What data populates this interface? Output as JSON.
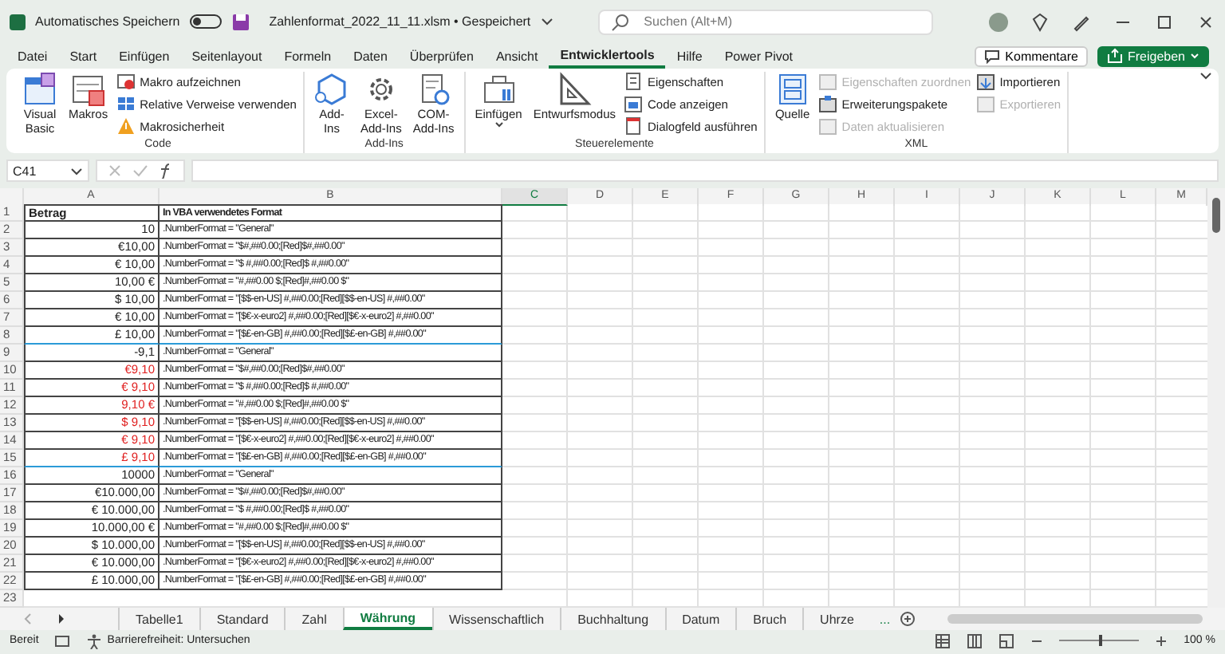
{
  "title_bar": {
    "autosave_label": "Automatisches Speichern",
    "autosave_on": false,
    "filename": "Zahlenformat_2022_11_11.xlsm • Gespeichert",
    "search_placeholder": "Suchen (Alt+M)"
  },
  "menu_tabs": [
    {
      "label": "Datei",
      "selected": false
    },
    {
      "label": "Start",
      "selected": false
    },
    {
      "label": "Einfügen",
      "selected": false
    },
    {
      "label": "Seitenlayout",
      "selected": false
    },
    {
      "label": "Formeln",
      "selected": false
    },
    {
      "label": "Daten",
      "selected": false
    },
    {
      "label": "Überprüfen",
      "selected": false
    },
    {
      "label": "Ansicht",
      "selected": false
    },
    {
      "label": "Entwicklertools",
      "selected": true
    },
    {
      "label": "Hilfe",
      "selected": false
    },
    {
      "label": "Power Pivot",
      "selected": false
    }
  ],
  "header_buttons": {
    "comments": "Kommentare",
    "share": "Freigeben"
  },
  "ribbon_groups": [
    {
      "label": "Code",
      "items": [
        {
          "label": "Visual\nBasic",
          "kind": "large",
          "disabled": false
        },
        {
          "label": "Makros",
          "kind": "large",
          "disabled": false
        },
        {
          "label": "Makro aufzeichnen",
          "kind": "small",
          "disabled": false
        },
        {
          "label": "Relative Verweise verwenden",
          "kind": "small",
          "disabled": false
        },
        {
          "label": "Makrosicherheit",
          "kind": "small",
          "disabled": false
        }
      ]
    },
    {
      "label": "Add-Ins",
      "items": [
        {
          "label": "Add-\nIns",
          "kind": "large",
          "disabled": false
        },
        {
          "label": "Excel-\nAdd-Ins",
          "kind": "large",
          "disabled": false
        },
        {
          "label": "COM-\nAdd-Ins",
          "kind": "large",
          "disabled": false
        }
      ]
    },
    {
      "label": "Steuerelemente",
      "items": [
        {
          "label": "Einfügen",
          "kind": "dropdown",
          "disabled": false
        },
        {
          "label": "Entwurfsmodus",
          "kind": "large",
          "disabled": false
        },
        {
          "label": "Eigenschaften",
          "kind": "small",
          "disabled": false
        },
        {
          "label": "Code anzeigen",
          "kind": "small",
          "disabled": false
        },
        {
          "label": "Dialogfeld ausführen",
          "kind": "small",
          "disabled": false
        }
      ]
    },
    {
      "label": "XML",
      "items": [
        {
          "label": "Quelle",
          "kind": "large",
          "disabled": false
        },
        {
          "label": "Eigenschaften zuordnen",
          "kind": "small",
          "disabled": true
        },
        {
          "label": "Erweiterungspakete",
          "kind": "small",
          "disabled": false
        },
        {
          "label": "Daten aktualisieren",
          "kind": "small",
          "disabled": true
        },
        {
          "label": "Importieren",
          "kind": "small",
          "disabled": false
        },
        {
          "label": "Exportieren",
          "kind": "small",
          "disabled": true
        }
      ]
    }
  ],
  "formula_bar": {
    "name_box": "C41"
  },
  "columns": [
    {
      "label": "A",
      "selected": false
    },
    {
      "label": "B",
      "selected": false
    },
    {
      "label": "C",
      "selected": true
    },
    {
      "label": "D",
      "selected": false
    },
    {
      "label": "E",
      "selected": false
    },
    {
      "label": "F",
      "selected": false
    },
    {
      "label": "G",
      "selected": false
    },
    {
      "label": "H",
      "selected": false
    },
    {
      "label": "I",
      "selected": false
    },
    {
      "label": "J",
      "selected": false
    },
    {
      "label": "K",
      "selected": false
    },
    {
      "label": "L",
      "selected": false
    },
    {
      "label": "M",
      "selected": false
    }
  ],
  "rows": [
    {
      "number": "1",
      "a": "Betrag",
      "b": "In VBA verwendetes Format",
      "header": true,
      "red": false,
      "blue_line_below": false
    },
    {
      "number": "2",
      "a": "10",
      "b": ".NumberFormat = \"General\"",
      "header": false,
      "red": false,
      "blue_line_below": false
    },
    {
      "number": "3",
      "a": "€10,00",
      "b": ".NumberFormat = \"$#,##0.00;[Red]$#,##0.00\"",
      "header": false,
      "red": false,
      "blue_line_below": false
    },
    {
      "number": "4",
      "a": "€ 10,00",
      "b": ".NumberFormat = \"$ #,##0.00;[Red]$ #,##0.00\"",
      "header": false,
      "red": false,
      "blue_line_below": false
    },
    {
      "number": "5",
      "a": "10,00 €",
      "b": ".NumberFormat = \"#,##0.00 $;[Red]#,##0.00 $\"",
      "header": false,
      "red": false,
      "blue_line_below": false
    },
    {
      "number": "6",
      "a": "$ 10,00",
      "b": ".NumberFormat = \"[$$-en-US] #,##0.00;[Red][$$-en-US] #,##0.00\"",
      "header": false,
      "red": false,
      "blue_line_below": false
    },
    {
      "number": "7",
      "a": "€ 10,00",
      "b": ".NumberFormat = \"[$€-x-euro2] #,##0.00;[Red][$€-x-euro2] #,##0.00\"",
      "header": false,
      "red": false,
      "blue_line_below": false
    },
    {
      "number": "8",
      "a": "£ 10,00",
      "b": ".NumberFormat = \"[$£-en-GB] #,##0.00;[Red][$£-en-GB] #,##0.00\"",
      "header": false,
      "red": false,
      "blue_line_below": true
    },
    {
      "number": "9",
      "a": "-9,1",
      "b": ".NumberFormat = \"General\"",
      "header": false,
      "red": false,
      "blue_line_below": false
    },
    {
      "number": "10",
      "a": "€9,10",
      "b": ".NumberFormat = \"$#,##0.00;[Red]$#,##0.00\"",
      "header": false,
      "red": true,
      "blue_line_below": false
    },
    {
      "number": "11",
      "a": "€ 9,10",
      "b": ".NumberFormat = \"$ #,##0.00;[Red]$ #,##0.00\"",
      "header": false,
      "red": true,
      "blue_line_below": false
    },
    {
      "number": "12",
      "a": "9,10 €",
      "b": ".NumberFormat = \"#,##0.00 $;[Red]#,##0.00 $\"",
      "header": false,
      "red": true,
      "blue_line_below": false
    },
    {
      "number": "13",
      "a": "$ 9,10",
      "b": ".NumberFormat = \"[$$-en-US] #,##0.00;[Red][$$-en-US] #,##0.00\"",
      "header": false,
      "red": true,
      "blue_line_below": false
    },
    {
      "number": "14",
      "a": "€ 9,10",
      "b": ".NumberFormat = \"[$€-x-euro2] #,##0.00;[Red][$€-x-euro2] #,##0.00\"",
      "header": false,
      "red": true,
      "blue_line_below": false
    },
    {
      "number": "15",
      "a": "£ 9,10",
      "b": ".NumberFormat = \"[$£-en-GB] #,##0.00;[Red][$£-en-GB] #,##0.00\"",
      "header": false,
      "red": true,
      "blue_line_below": true
    },
    {
      "number": "16",
      "a": "10000",
      "b": ".NumberFormat = \"General\"",
      "header": false,
      "red": false,
      "blue_line_below": false
    },
    {
      "number": "17",
      "a": "€10.000,00",
      "b": ".NumberFormat = \"$#,##0.00;[Red]$#,##0.00\"",
      "header": false,
      "red": false,
      "blue_line_below": false
    },
    {
      "number": "18",
      "a": "€ 10.000,00",
      "b": ".NumberFormat = \"$ #,##0.00;[Red]$ #,##0.00\"",
      "header": false,
      "red": false,
      "blue_line_below": false
    },
    {
      "number": "19",
      "a": "10.000,00 €",
      "b": ".NumberFormat = \"#,##0.00 $;[Red]#,##0.00 $\"",
      "header": false,
      "red": false,
      "blue_line_below": false
    },
    {
      "number": "20",
      "a": "$ 10.000,00",
      "b": ".NumberFormat = \"[$$-en-US] #,##0.00;[Red][$$-en-US] #,##0.00\"",
      "header": false,
      "red": false,
      "blue_line_below": false
    },
    {
      "number": "21",
      "a": "€ 10.000,00",
      "b": ".NumberFormat = \"[$€-x-euro2] #,##0.00;[Red][$€-x-euro2] #,##0.00\"",
      "header": false,
      "red": false,
      "blue_line_below": false
    },
    {
      "number": "22",
      "a": "£ 10.000,00",
      "b": ".NumberFormat = \"[$£-en-GB] #,##0.00;[Red][$£-en-GB] #,##0.00\"",
      "header": false,
      "red": false,
      "blue_line_below": false
    }
  ],
  "empty_rows": [
    "23"
  ],
  "sheet_tabs": [
    {
      "label": "Tabelle1",
      "selected": false
    },
    {
      "label": "Standard",
      "selected": false
    },
    {
      "label": "Zahl",
      "selected": false
    },
    {
      "label": "Währung",
      "selected": true
    },
    {
      "label": "Wissenschaftlich",
      "selected": false
    },
    {
      "label": "Buchhaltung",
      "selected": false
    },
    {
      "label": "Datum",
      "selected": false
    },
    {
      "label": "Bruch",
      "selected": false
    },
    {
      "label": "Uhrze",
      "selected": false
    }
  ],
  "sheet_tabs_more": "...",
  "status_bar": {
    "ready": "Bereit",
    "accessibility": "Barrierefreiheit: Untersuchen",
    "zoom": "100 %",
    "zoom_slider": {
      "level": 0.5
    }
  }
}
